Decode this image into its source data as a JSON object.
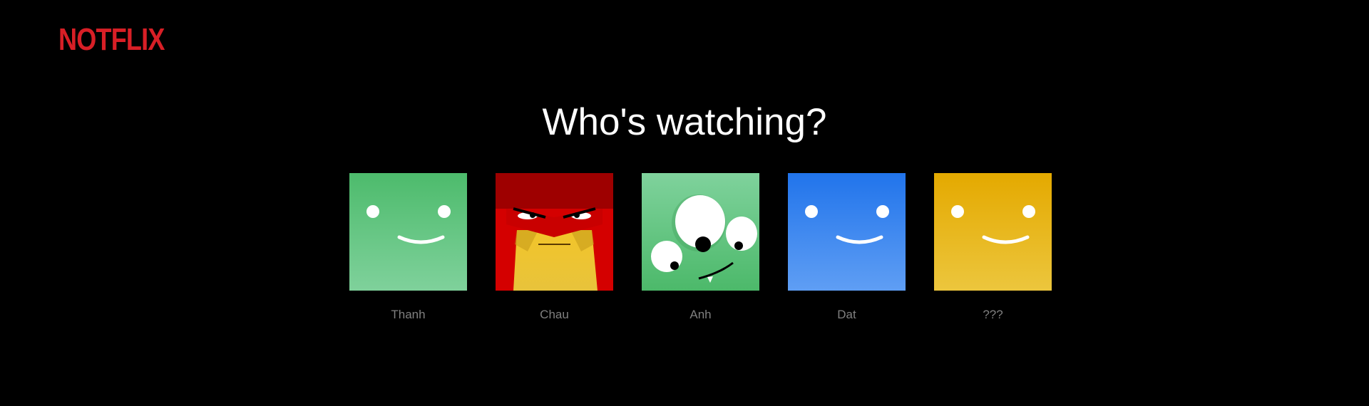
{
  "header": {
    "logo_text": "NOTFLIX",
    "brand_color": "#d81f26"
  },
  "main": {
    "title": "Who's watching?",
    "profiles": [
      {
        "name": "Thanh",
        "avatar": "smiley-face-icon",
        "color": "#54b970"
      },
      {
        "name": "Chau",
        "avatar": "angry-red-face-icon",
        "color": "#d10000"
      },
      {
        "name": "Anh",
        "avatar": "three-eyed-monster-icon",
        "color": "#5cc47a"
      },
      {
        "name": "Dat",
        "avatar": "smiley-face-icon",
        "color": "#2f7ef0"
      },
      {
        "name": "???",
        "avatar": "smiley-face-icon",
        "color": "#e5b400"
      }
    ]
  }
}
